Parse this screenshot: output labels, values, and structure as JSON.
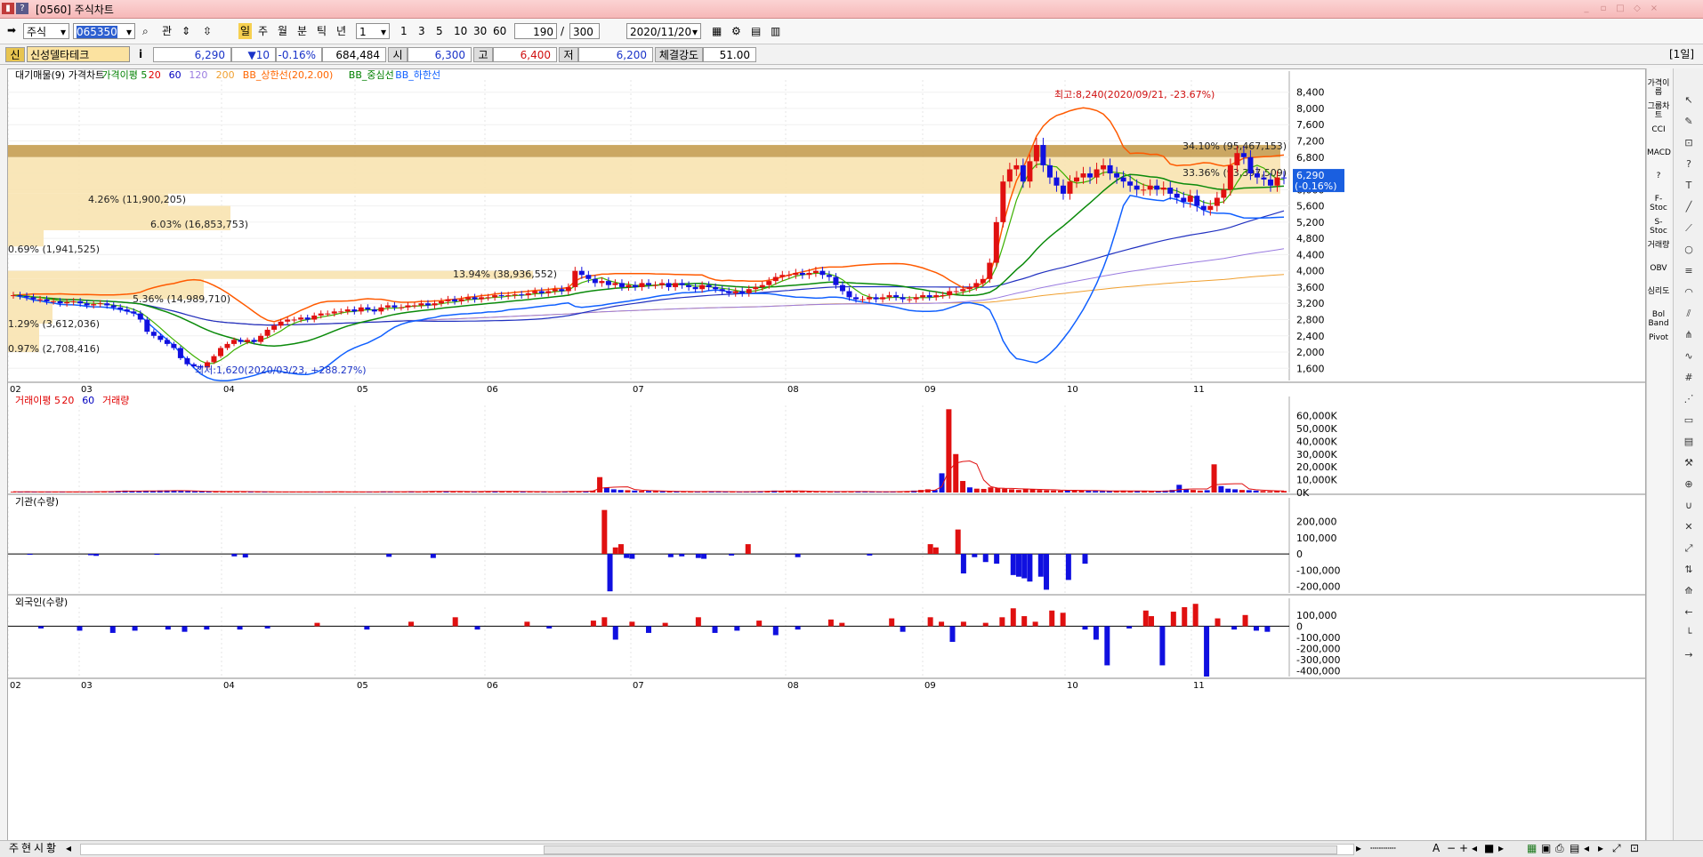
{
  "window": {
    "title": "[0560] 주식차트",
    "help_glyph": "?",
    "right_tag": "[1일]"
  },
  "toolbar": {
    "mode": "주식",
    "code": "065350",
    "btn_gwan": "관",
    "periods": [
      "일",
      "주",
      "월",
      "분",
      "틱",
      "년"
    ],
    "interval_select": "1",
    "interval_buttons": [
      "1",
      "3",
      "5",
      "10",
      "30",
      "60"
    ],
    "count": "190",
    "slash": "/",
    "total": "300",
    "date": "2020/11/20"
  },
  "quote": {
    "badge": "신",
    "name": "신성델타테크",
    "info_btn": "i",
    "price": "6,290",
    "change": "▼10",
    "change_pct": "-0.16%",
    "volume": "684,484",
    "open_label": "시",
    "open": "6,300",
    "high_label": "고",
    "high": "6,400",
    "low_label": "저",
    "low": "6,200",
    "strength_label": "체결강도",
    "strength": "51.00"
  },
  "legend_main": [
    {
      "text": "대기매물(9)",
      "color": "#000000"
    },
    {
      "text": "가격차트",
      "color": "#000000"
    },
    {
      "text": "가격이평 5",
      "color": "#008000"
    },
    {
      "text": "20",
      "color": "#e00000"
    },
    {
      "text": "60",
      "color": "#0000c0"
    },
    {
      "text": "120",
      "color": "#9a7be0"
    },
    {
      "text": "200",
      "color": "#f0a030"
    },
    {
      "text": "BB_상한선(20,2.00)",
      "color": "#ff6600"
    },
    {
      "text": "BB_중심선",
      "color": "#008000"
    },
    {
      "text": "BB_하한선",
      "color": "#1060ff"
    }
  ],
  "legend_vol": [
    {
      "text": "거래이평 5",
      "color": "#e00000"
    },
    {
      "text": "20",
      "color": "#e00000"
    },
    {
      "text": "60",
      "color": "#0000c0"
    },
    {
      "text": "거래량",
      "color": "#e00000"
    }
  ],
  "legend_inst": "기관(수량)",
  "legend_foreign": "외국인(수량)",
  "annotations": {
    "high": "최고:8,240(2020/09/21, -23.67%)",
    "low": "최저:1,620(2020/03/23, +288.27%)"
  },
  "price_tag": {
    "value": "6,290",
    "pct": "(-0.16%)"
  },
  "volume_profile": [
    {
      "label": "34.10% (95,467,153)",
      "price_lo": 6800,
      "price_hi": 7100
    },
    {
      "label": "33.36% (93,397,509)",
      "price_lo": 5900,
      "price_hi": 6800
    },
    {
      "label": "4.26% (11,900,205)",
      "price_lo": 5600,
      "price_hi": 5900
    },
    {
      "label": "6.03% (16,853,753)",
      "price_lo": 5000,
      "price_hi": 5600
    },
    {
      "label": "0.69% (1,941,525)",
      "price_lo": 4600,
      "price_hi": 5000
    },
    {
      "label": "13.94% (38,936,552)",
      "price_lo": 3800,
      "price_hi": 4000
    },
    {
      "label": "5.36% (14,989,710)",
      "price_lo": 3300,
      "price_hi": 3800
    },
    {
      "label": "1.29% (3,612,036)",
      "price_lo": 2700,
      "price_hi": 3300
    },
    {
      "label": "0.97% (2,708,416)",
      "price_lo": 2000,
      "price_hi": 2700
    }
  ],
  "chart_data": [
    {
      "type": "candlestick",
      "title": "가격차트",
      "x_months": [
        "02",
        "03",
        "04",
        "05",
        "06",
        "07",
        "08",
        "09",
        "10",
        "11"
      ],
      "y_ticks": [
        "8,400",
        "8,000",
        "7,600",
        "7,200",
        "6,800",
        "6,400",
        "6,000",
        "5,600",
        "5,200",
        "4,800",
        "4,400",
        "4,000",
        "3,600",
        "3,200",
        "2,800",
        "2,400",
        "2,000",
        "1,600"
      ],
      "ylim": [
        1300,
        8700
      ],
      "close_series": [
        3400,
        3380,
        3350,
        3300,
        3300,
        3250,
        3250,
        3200,
        3230,
        3250,
        3200,
        3150,
        3180,
        3200,
        3150,
        3100,
        3050,
        3000,
        2950,
        2800,
        2500,
        2400,
        2300,
        2200,
        2100,
        1850,
        1700,
        1650,
        1620,
        1750,
        1900,
        2100,
        2200,
        2300,
        2250,
        2300,
        2250,
        2400,
        2550,
        2650,
        2750,
        2800,
        2800,
        2850,
        2800,
        2900,
        2950,
        2950,
        3000,
        3000,
        3050,
        3000,
        3100,
        3050,
        3000,
        3100,
        3150,
        3100,
        3100,
        3150,
        3150,
        3200,
        3150,
        3200,
        3250,
        3300,
        3250,
        3300,
        3350,
        3300,
        3350,
        3350,
        3400,
        3380,
        3400,
        3420,
        3400,
        3450,
        3500,
        3450,
        3500,
        3550,
        3500,
        3600,
        4000,
        3900,
        3800,
        3700,
        3750,
        3650,
        3700,
        3600,
        3650,
        3600,
        3700,
        3650,
        3650,
        3700,
        3600,
        3700,
        3650,
        3600,
        3550,
        3650,
        3600,
        3550,
        3500,
        3450,
        3500,
        3450,
        3550,
        3600,
        3650,
        3750,
        3850,
        3900,
        3900,
        3950,
        3900,
        3950,
        4000,
        3900,
        3850,
        3650,
        3500,
        3350,
        3300,
        3300,
        3350,
        3300,
        3350,
        3400,
        3350,
        3300,
        3300,
        3350,
        3400,
        3350,
        3400,
        3400,
        3500,
        3500,
        3550,
        3600,
        3700,
        3800,
        4200,
        5200,
        6200,
        6500,
        6600,
        6200,
        6700,
        7100,
        6600,
        6300,
        6100,
        5900,
        6200,
        6300,
        6400,
        6300,
        6500,
        6600,
        6400,
        6300,
        6200,
        6100,
        6000,
        6000,
        6100,
        6000,
        6050,
        5900,
        5800,
        5700,
        5850,
        5600,
        5500,
        5600,
        5800,
        6000,
        6600,
        6900,
        6800,
        6400,
        6300,
        6250,
        6100,
        6300,
        6290
      ],
      "ma_periods": [
        5,
        20,
        60,
        120,
        200
      ],
      "bollinger": {
        "period": 20,
        "k": 2.0
      }
    },
    {
      "type": "bar",
      "title": "거래량",
      "y_ticks": [
        "60,000K",
        "50,000K",
        "40,000K",
        "30,000K",
        "20,000K",
        "10,000K",
        "0K"
      ],
      "ylim": [
        0,
        68000
      ],
      "values_k": [
        600,
        500,
        700,
        400,
        500,
        600,
        500,
        400,
        500,
        600,
        700,
        500,
        800,
        900,
        700,
        1200,
        1500,
        1300,
        900,
        1100,
        1400,
        1600,
        1700,
        1400,
        1200,
        1000,
        900,
        800,
        700,
        700,
        800,
        900,
        700,
        600,
        500,
        700,
        600,
        600,
        500,
        500,
        600,
        500,
        600,
        700,
        500,
        500,
        700,
        600,
        500,
        600,
        500,
        600,
        700,
        800,
        600,
        500,
        600,
        800,
        700,
        900,
        1000,
        900,
        800,
        700,
        600,
        700,
        800,
        1000,
        900,
        800,
        700,
        800,
        900,
        700,
        600,
        500,
        600,
        700,
        800,
        900,
        1000,
        900,
        800,
        1500,
        12000,
        4000,
        2500,
        2000,
        1800,
        1500,
        1300,
        1200,
        1000,
        900,
        800,
        700,
        600,
        700,
        800,
        900,
        700,
        600,
        500,
        600,
        700,
        800,
        700,
        900,
        1200,
        1500,
        1300,
        1100,
        1000,
        900,
        800,
        700,
        600,
        700,
        800,
        900,
        800,
        700,
        600,
        500,
        600,
        700,
        800,
        900,
        1000,
        1500,
        2000,
        2500,
        2000,
        15000,
        65000,
        30000,
        9000,
        4000,
        3000,
        2800,
        4000,
        3500,
        3000,
        2500,
        2000,
        3000,
        2500,
        2000,
        1800,
        1600,
        1500,
        1800,
        2000,
        1500,
        1300,
        1200,
        1000,
        1100,
        1300,
        1500,
        1200,
        1000,
        1100,
        900,
        1000,
        1500,
        2000,
        6000,
        2500,
        2000,
        1500,
        1800,
        22000,
        5000,
        3000,
        2500,
        2000,
        1800,
        1500,
        1200,
        1000,
        1100,
        1200
      ]
    },
    {
      "type": "bar",
      "title": "기관(수량)",
      "y_ticks": [
        "200,000",
        "100,000",
        "0",
        "-100,000",
        "-200,000"
      ],
      "ylim": [
        -240000,
        290000
      ],
      "bars_k": [
        [
          3,
          -5
        ],
        [
          14,
          -8
        ],
        [
          15,
          -12
        ],
        [
          26,
          -3
        ],
        [
          40,
          -15
        ],
        [
          42,
          -22
        ],
        [
          68,
          -18
        ],
        [
          76,
          -25
        ],
        [
          107,
          270
        ],
        [
          108,
          -230
        ],
        [
          109,
          40
        ],
        [
          110,
          60
        ],
        [
          111,
          -25
        ],
        [
          112,
          -30
        ],
        [
          119,
          -20
        ],
        [
          121,
          -15
        ],
        [
          124,
          -25
        ],
        [
          125,
          -30
        ],
        [
          130,
          -10
        ],
        [
          133,
          60
        ],
        [
          142,
          -20
        ],
        [
          155,
          -10
        ],
        [
          166,
          60
        ],
        [
          167,
          40
        ],
        [
          171,
          150
        ],
        [
          172,
          -120
        ],
        [
          174,
          -20
        ],
        [
          176,
          -50
        ],
        [
          178,
          -60
        ],
        [
          181,
          -130
        ],
        [
          182,
          -140
        ],
        [
          183,
          -150
        ],
        [
          184,
          -170
        ],
        [
          186,
          -140
        ],
        [
          187,
          -220
        ],
        [
          191,
          -160
        ],
        [
          194,
          -60
        ]
      ]
    },
    {
      "type": "bar",
      "title": "외국인(수량)",
      "y_ticks": [
        "100,000",
        "0",
        "-100,000",
        "-200,000",
        "-300,000",
        "-400,000"
      ],
      "ylim": [
        -450000,
        170000
      ],
      "bars_k": [
        [
          5,
          -20
        ],
        [
          12,
          -40
        ],
        [
          18,
          -60
        ],
        [
          22,
          -40
        ],
        [
          28,
          -30
        ],
        [
          31,
          -50
        ],
        [
          35,
          -30
        ],
        [
          41,
          -30
        ],
        [
          46,
          -20
        ],
        [
          55,
          30
        ],
        [
          64,
          -30
        ],
        [
          72,
          40
        ],
        [
          80,
          80
        ],
        [
          84,
          -30
        ],
        [
          93,
          40
        ],
        [
          97,
          -20
        ],
        [
          105,
          50
        ],
        [
          107,
          80
        ],
        [
          109,
          -120
        ],
        [
          112,
          40
        ],
        [
          115,
          -60
        ],
        [
          118,
          30
        ],
        [
          124,
          80
        ],
        [
          127,
          -60
        ],
        [
          131,
          -40
        ],
        [
          135,
          50
        ],
        [
          138,
          -80
        ],
        [
          142,
          -30
        ],
        [
          148,
          60
        ],
        [
          150,
          30
        ],
        [
          159,
          70
        ],
        [
          161,
          -50
        ],
        [
          166,
          80
        ],
        [
          168,
          40
        ],
        [
          170,
          -140
        ],
        [
          172,
          40
        ],
        [
          176,
          30
        ],
        [
          179,
          80
        ],
        [
          181,
          160
        ],
        [
          183,
          90
        ],
        [
          185,
          40
        ],
        [
          188,
          140
        ],
        [
          190,
          120
        ],
        [
          194,
          -30
        ],
        [
          196,
          -120
        ],
        [
          198,
          -350
        ],
        [
          202,
          -20
        ],
        [
          205,
          140
        ],
        [
          206,
          90
        ],
        [
          208,
          -350
        ],
        [
          210,
          130
        ],
        [
          212,
          170
        ],
        [
          214,
          200
        ],
        [
          216,
          -450
        ],
        [
          218,
          70
        ],
        [
          221,
          -30
        ],
        [
          223,
          100
        ],
        [
          225,
          -40
        ],
        [
          227,
          -50
        ]
      ]
    }
  ],
  "bottom": {
    "tabs": [
      "주",
      "현",
      "시",
      "황"
    ]
  },
  "side_indicators": [
    "가격이름",
    "그룹차트",
    "CCI",
    "MACD",
    "?",
    "F-Stoc",
    "S-Stoc",
    "거래량",
    "OBV",
    "심리도",
    "Bol Band",
    "Pivot"
  ]
}
